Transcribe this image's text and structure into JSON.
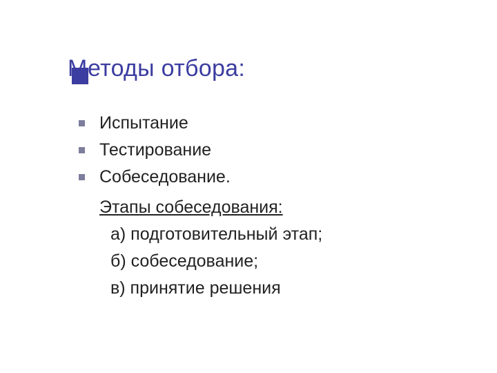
{
  "title": "Методы отбора:",
  "bullets": [
    "Испытание",
    "Тестирование",
    "Собеседование."
  ],
  "subheading": "Этапы собеседования:",
  "lettered": [
    "а) подготовительный этап;",
    "б) собеседование;",
    "в) принятие решения"
  ]
}
